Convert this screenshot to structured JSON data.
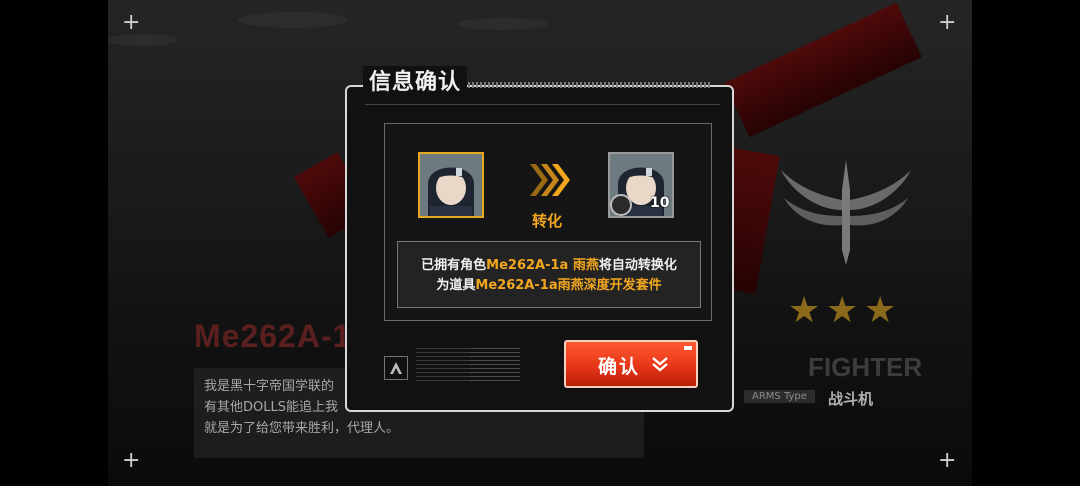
{
  "background": {
    "character_name": "Me262A-1",
    "description": "我是黑十字帝国学联的Me262A-1a，有其他DOLLS能追上我的速度，就是为了给您带来胜利，代理人。",
    "description_lines": [
      "我是黑十字帝国学联的",
      "有其他DOLLS能追上我",
      "就是为了给您带来胜利，代理人。"
    ],
    "stars": 3,
    "arms_type_title": "FIGHTER",
    "arms_type_tag": "ARMS Type",
    "arms_type_value": "战斗机"
  },
  "dialog": {
    "title": "信息确认",
    "convert_label": "转化",
    "item_count": "10",
    "message": {
      "line1_prefix": "已拥有角色",
      "line1_highlight": "Me262A-1a 雨燕",
      "line1_suffix": "将自动转换化",
      "line2_prefix": "为道具",
      "line2_highlight": "Me262A-1a雨燕深度开发套件"
    },
    "confirm_label": "确认"
  },
  "icons": {
    "convert_arrows": "chevrons-right-icon",
    "gear": "gear-icon",
    "confirm_arrow": "chevron-down-icon"
  },
  "colors": {
    "accent": "#f2a71e",
    "confirm_button": "#e8361a"
  }
}
